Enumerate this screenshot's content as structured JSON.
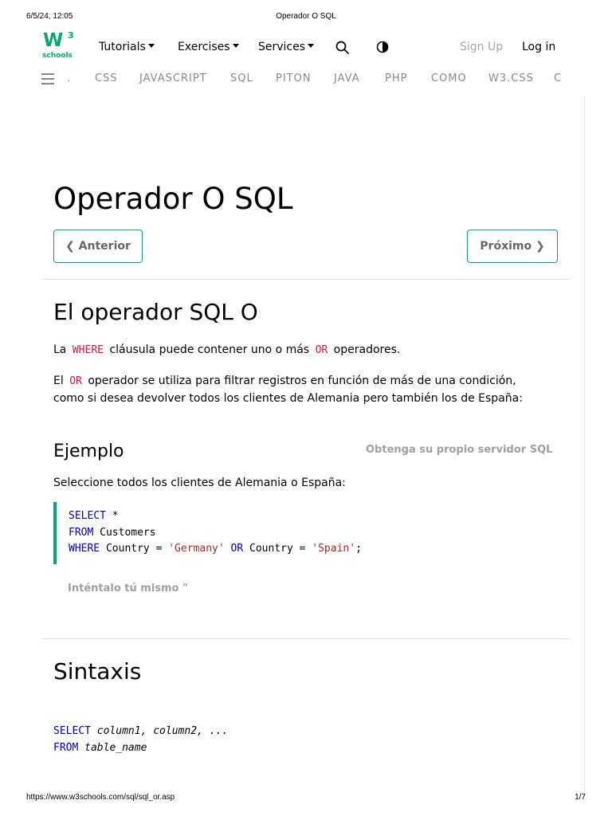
{
  "print": {
    "datetime": "6/5/24, 12:05",
    "doc_title": "Operador O SQL",
    "url": "https://www.w3schools.com/sql/sql_or.asp",
    "page": "1/7"
  },
  "logo": {
    "main": "W",
    "sup": "3",
    "sub": "schools"
  },
  "topnav": {
    "tutorials": "Tutorials",
    "exercises": "Exercises",
    "services": "Services",
    "signup": "Sign Up",
    "login": "Log in"
  },
  "subnav": {
    "items": [
      ".",
      "CSS",
      "JAVASCRIPT",
      "SQL",
      "PITÓN",
      "JAVA",
      "PHP",
      "CÓMO",
      "W3.CSS",
      "C"
    ]
  },
  "page_title": "Operador O SQL",
  "buttons": {
    "prev": "❮ Anterior",
    "next": "Próximo ❯"
  },
  "section": {
    "title": "El operador SQL O",
    "p1_a": "La",
    "p1_code1": "WHERE",
    "p1_b": "cláusula puede contener uno o más",
    "p1_code2": "OR",
    "p1_c": "operadores.",
    "p2_a": "El",
    "p2_code": "OR",
    "p2_b": "operador se utiliza para filtrar registros en función de más de una condición,",
    "p3": "como si desea devolver todos los clientes de Alemania pero también los de España:"
  },
  "example": {
    "title": "Ejemplo",
    "get_server": "Obtenga su propio servidor SQL",
    "intro": "Seleccione todos los clientes de Alemania o España:",
    "code": {
      "l1_kw": "SELECT",
      "l1_rest": " *",
      "l2_kw": "FROM",
      "l2_rest": " Customers",
      "l3_kw": "WHERE",
      "l3_a": " Country = ",
      "l3_s1": "'Germany'",
      "l3_or": " OR",
      "l3_b": " Country = ",
      "l3_s2": "'Spain'",
      "l3_end": ";"
    },
    "try_it": "Inténtalo tú mismo \""
  },
  "syntax": {
    "title": "Sintaxis",
    "l1_kw": "SELECT",
    "l1_rest": " column1, column2, ...",
    "l2_kw": "FROM",
    "l2_rest": " table_name"
  }
}
